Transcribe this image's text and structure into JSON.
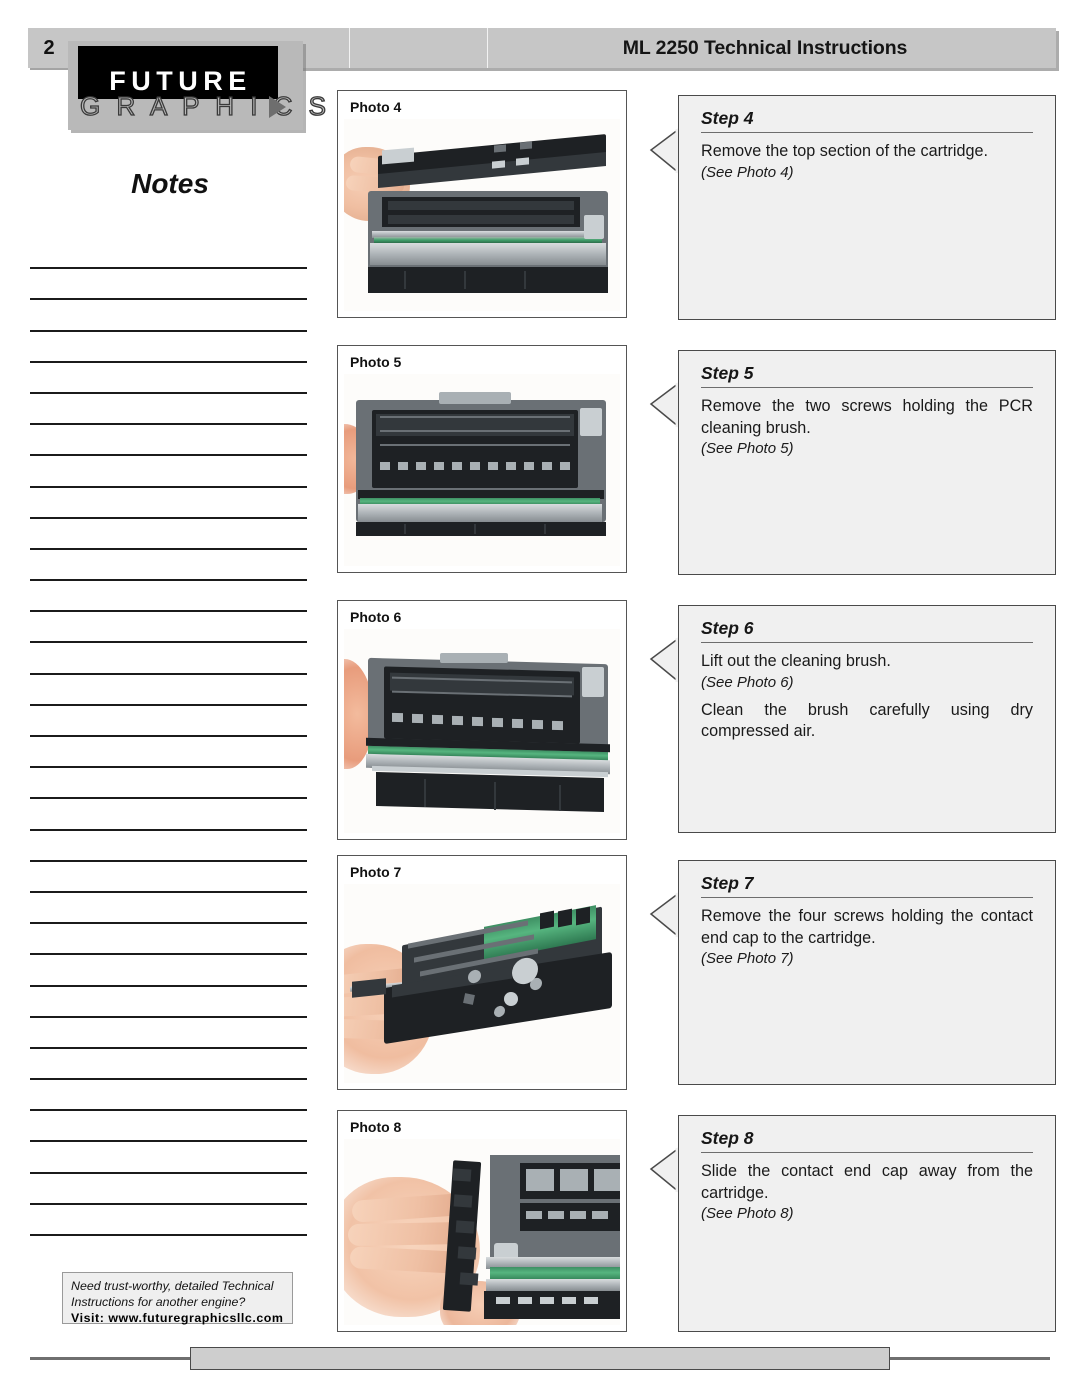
{
  "header": {
    "page_number": "2",
    "title": "ML 2250 Technical Instructions",
    "logo": {
      "line1": "FUTURE",
      "line2": "G R A P H I C S"
    }
  },
  "notes": {
    "title": "Notes",
    "line_count": 32
  },
  "promo": {
    "line1": "Need trust-worthy, detailed Technical",
    "line2": "Instructions for another engine?",
    "visit": "Visit: www.futuregraphicsllc.com"
  },
  "photos": [
    {
      "label": "Photo 4"
    },
    {
      "label": "Photo 5"
    },
    {
      "label": "Photo 6"
    },
    {
      "label": "Photo 7"
    },
    {
      "label": "Photo 8"
    }
  ],
  "steps": [
    {
      "title": "Step 4",
      "body": "Remove the top section of the cartridge.",
      "see": "(See Photo 4)",
      "extra": ""
    },
    {
      "title": "Step 5",
      "body": "Remove the two screws holding the PCR cleaning brush.",
      "see": "(See Photo 5)",
      "extra": ""
    },
    {
      "title": "Step 6",
      "body": "Lift out the cleaning brush.",
      "see": "(See Photo 6)",
      "extra": "Clean the brush carefully using dry compressed air."
    },
    {
      "title": "Step 7",
      "body": "Remove the four screws holding the contact end cap to the cartridge.",
      "see": "(See Photo 7)",
      "extra": ""
    },
    {
      "title": "Step 8",
      "body": "Slide the contact end cap away from the cartridge.",
      "see": "(See Photo 8)",
      "extra": ""
    }
  ],
  "colors": {
    "header_bar": "#c6c6c6",
    "callout_fill": "#f0f0f0",
    "callout_border": "#4a4a4a",
    "rule": "#6f6f6f"
  }
}
